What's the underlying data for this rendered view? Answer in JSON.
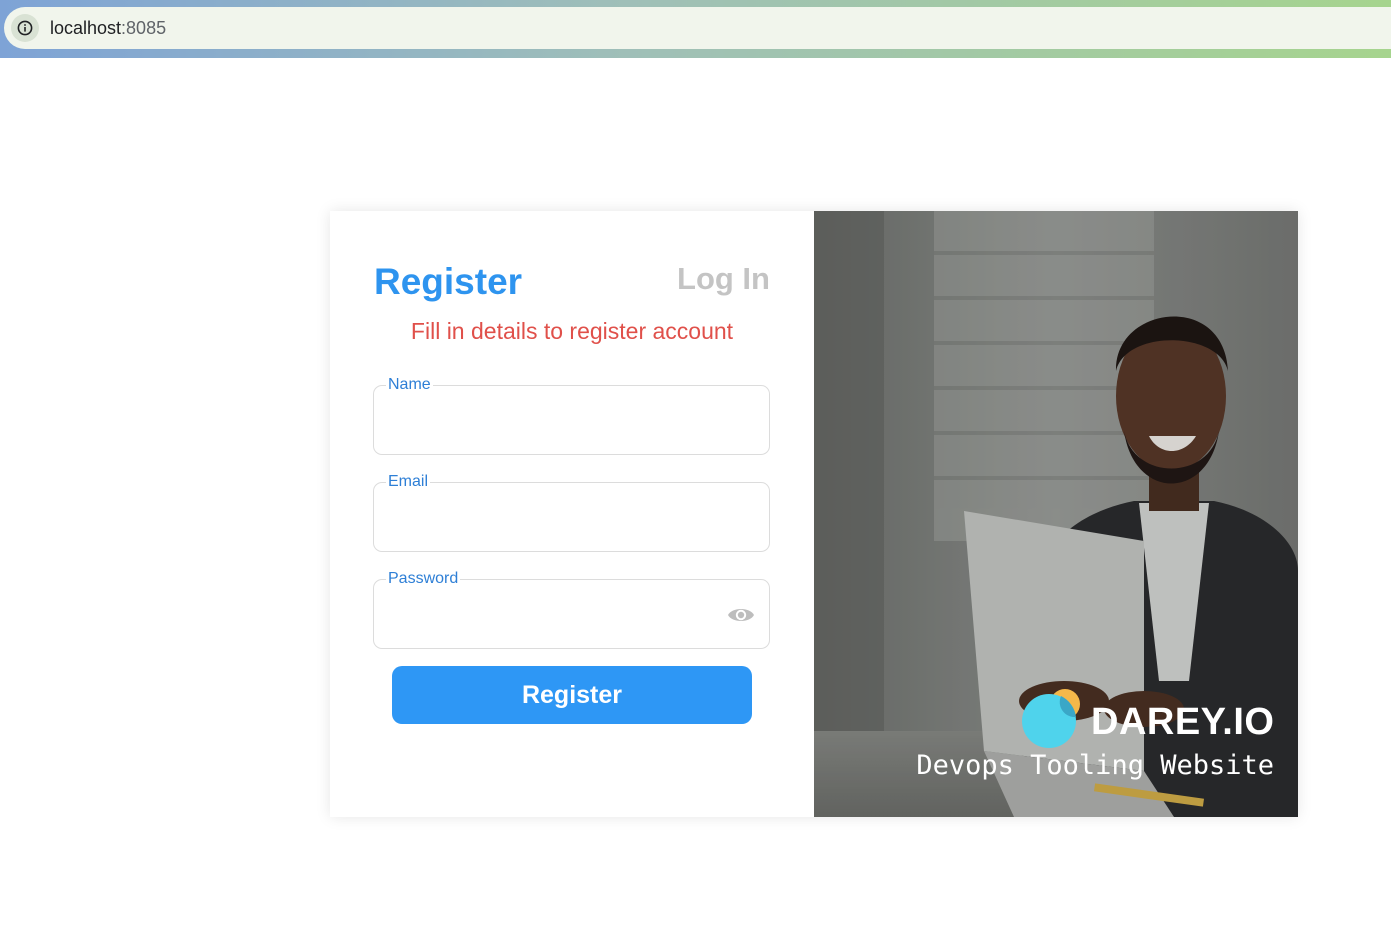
{
  "browser": {
    "url_host": "localhost",
    "url_port": ":8085",
    "info_icon": "info-icon"
  },
  "form": {
    "title": "Register",
    "alt_tab": "Log In",
    "subtitle": "Fill in details to register account",
    "fields": [
      {
        "label": "Name",
        "value": "",
        "type": "text"
      },
      {
        "label": "Email",
        "value": "",
        "type": "email"
      },
      {
        "label": "Password",
        "value": "",
        "type": "password",
        "icon": "eye-icon"
      }
    ],
    "submit_label": "Register"
  },
  "hero": {
    "brand_name": "DAREY.IO",
    "tagline": "Devops Tooling Website"
  },
  "colors": {
    "accent": "#2e94ef",
    "subtitle": "#e0504a",
    "inactive_tab": "#c4c4c4",
    "button": "#2e97f5"
  }
}
